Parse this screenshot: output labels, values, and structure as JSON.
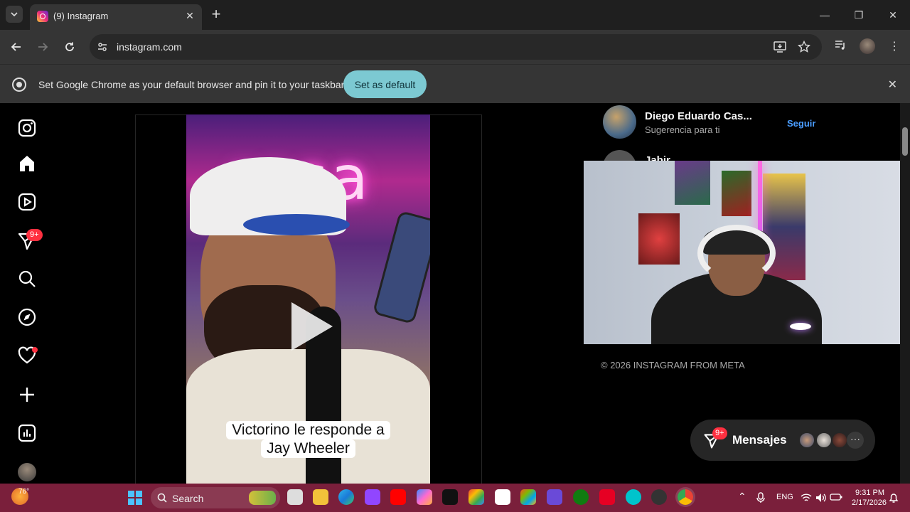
{
  "browser": {
    "tab_title": "(9) Instagram",
    "url": "instagram.com",
    "infobar_text": "Set Google Chrome as your default browser and pin it to your taskbar",
    "infobar_button": "Set as default"
  },
  "instagram": {
    "nav_badge": "9+",
    "video_caption_line1": "Victorino le responde a",
    "video_caption_line2": "Jay Wheeler",
    "suggestions": [
      {
        "name": "Diego Eduardo Cas...",
        "subtitle": "Sugerencia para ti",
        "action": "Seguir"
      },
      {
        "name": "Jabir"
      }
    ],
    "copyright": "© 2026 INSTAGRAM FROM META",
    "messages_label": "Mensajes",
    "messages_badge": "9+"
  },
  "taskbar": {
    "weather_temp": "76°",
    "search_label": "Search",
    "language": "ENG",
    "time": "9:31 PM",
    "date": "2/17/2026"
  },
  "colors": {
    "accent_follow": "#4a9dff",
    "badge_red": "#ff3040",
    "set_default_button": "#7cc9d2",
    "taskbar": "#7a1f3b"
  }
}
